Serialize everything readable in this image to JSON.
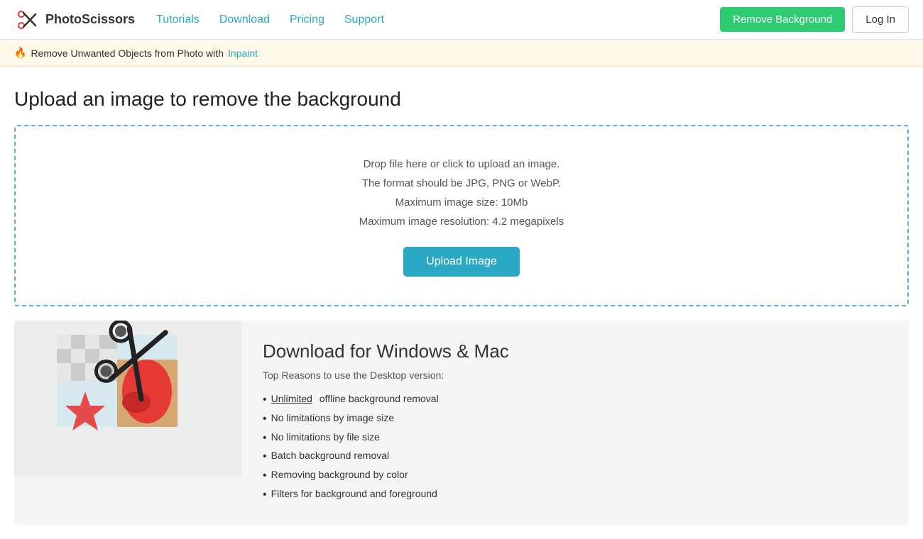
{
  "header": {
    "logo_text": "PhotoScissors",
    "nav_items": [
      {
        "label": "Tutorials",
        "href": "#"
      },
      {
        "label": "Download",
        "href": "#"
      },
      {
        "label": "Pricing",
        "href": "#"
      },
      {
        "label": "Support",
        "href": "#"
      }
    ],
    "remove_bg_label": "Remove Background",
    "login_label": "Log In"
  },
  "banner": {
    "icon": "🔥",
    "text": "Remove Unwanted Objects from Photo with",
    "link_text": "Inpaint",
    "link_href": "#"
  },
  "main": {
    "page_title": "Upload an image to remove the background",
    "upload": {
      "line1": "Drop file here or click to upload an image.",
      "line2": "The format should be JPG, PNG or WebP.",
      "line3": "Maximum image size: 10Mb",
      "line4": "Maximum image resolution: 4.2 megapixels",
      "button_label": "Upload Image"
    },
    "download": {
      "title": "Download for Windows & Mac",
      "subtitle": "Top Reasons to use the Desktop version:",
      "features": [
        {
          "text": "Unlimited",
          "underline": true,
          "rest": " offline background removal"
        },
        {
          "text": "No limitations by image size",
          "underline": false,
          "rest": ""
        },
        {
          "text": "No limitations by file size",
          "underline": false,
          "rest": ""
        },
        {
          "text": "Batch background removal",
          "underline": false,
          "rest": ""
        },
        {
          "text": "Removing background by color",
          "underline": false,
          "rest": ""
        },
        {
          "text": "Filters for background and foreground",
          "underline": false,
          "rest": ""
        }
      ]
    }
  }
}
